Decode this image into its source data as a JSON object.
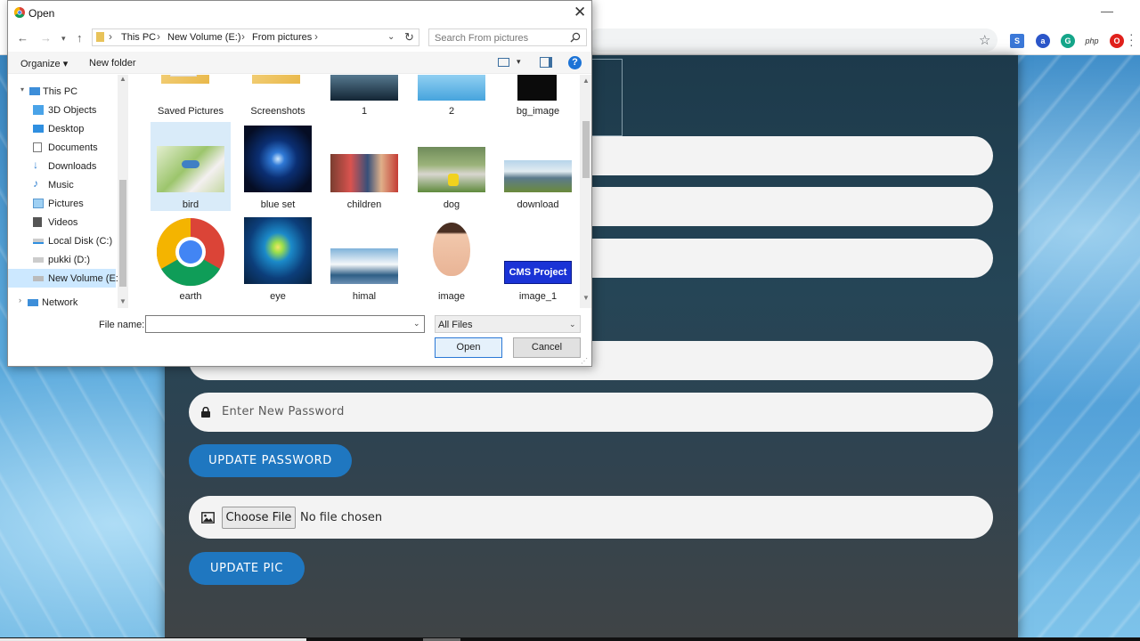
{
  "dialog": {
    "title": "Open",
    "breadcrumbs": [
      "This PC",
      "New Volume (E:)",
      "From pictures"
    ],
    "search_placeholder": "Search From pictures",
    "toolbar": {
      "organize": "Organize ▾",
      "new_folder": "New folder"
    },
    "nav_items": [
      {
        "label": "This PC",
        "icon": "computer-icon"
      },
      {
        "label": "3D Objects",
        "icon": "cube-icon"
      },
      {
        "label": "Desktop",
        "icon": "desktop-icon"
      },
      {
        "label": "Documents",
        "icon": "document-icon"
      },
      {
        "label": "Downloads",
        "icon": "download-icon"
      },
      {
        "label": "Music",
        "icon": "music-icon"
      },
      {
        "label": "Pictures",
        "icon": "pictures-icon"
      },
      {
        "label": "Videos",
        "icon": "video-icon"
      },
      {
        "label": "Local Disk (C:)",
        "icon": "drive-icon"
      },
      {
        "label": "pukki (D:)",
        "icon": "drive-icon"
      },
      {
        "label": "New Volume (E:)",
        "icon": "drive-icon",
        "selected": true
      },
      {
        "label": "Network",
        "icon": "network-icon"
      }
    ],
    "files": [
      {
        "name": "Saved Pictures",
        "kind": "folder"
      },
      {
        "name": "Screenshots",
        "kind": "folder"
      },
      {
        "name": "1",
        "kind": "image"
      },
      {
        "name": "2",
        "kind": "image"
      },
      {
        "name": "bg_image",
        "kind": "image"
      },
      {
        "name": "bird",
        "kind": "image",
        "selected": true
      },
      {
        "name": "blue set",
        "kind": "image"
      },
      {
        "name": "children",
        "kind": "image"
      },
      {
        "name": "dog",
        "kind": "image"
      },
      {
        "name": "download",
        "kind": "image"
      },
      {
        "name": "earth",
        "kind": "image"
      },
      {
        "name": "eye",
        "kind": "image"
      },
      {
        "name": "himal",
        "kind": "image"
      },
      {
        "name": "image",
        "kind": "image"
      },
      {
        "name": "image_1",
        "kind": "image",
        "thumb_text": "CMS Project"
      }
    ],
    "file_name_label": "File name:",
    "file_name_value": "",
    "file_type": "All Files",
    "open_label": "Open",
    "cancel_label": "Cancel"
  },
  "page": {
    "new_password_placeholder": "Enter New Password",
    "update_password_label": "UPDATE PASSWORD",
    "choose_file_label": "Choose File",
    "no_file_text": "No file chosen",
    "update_pic_label": "UPDATE PIC"
  },
  "browser": {
    "extensions": [
      "s-icon",
      "a-icon",
      "grammarly-icon",
      "php-icon",
      "opera-icon"
    ],
    "ext_php_label": "php"
  },
  "colors": {
    "accent_button": "#1f77c0",
    "dialog_selection": "#cce8ff",
    "panel_bg": "#254556"
  }
}
